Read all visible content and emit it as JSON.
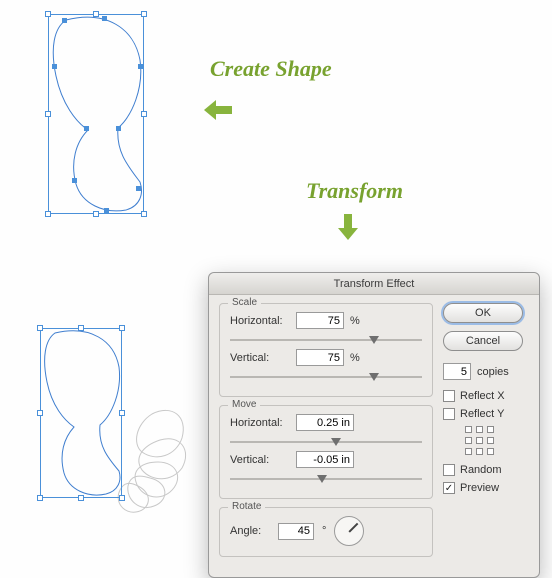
{
  "annotations": {
    "create_shape": "Create Shape",
    "transform": "Transform"
  },
  "dialog": {
    "title": "Transform Effect",
    "groups": {
      "scale": {
        "legend": "Scale",
        "horizontal_label": "Horizontal:",
        "horizontal_value": "75",
        "horizontal_unit": "%",
        "vertical_label": "Vertical:",
        "vertical_value": "75",
        "vertical_unit": "%"
      },
      "move": {
        "legend": "Move",
        "horizontal_label": "Horizontal:",
        "horizontal_value": "0.25 in",
        "vertical_label": "Vertical:",
        "vertical_value": "-0.05 in"
      },
      "rotate": {
        "legend": "Rotate",
        "angle_label": "Angle:",
        "angle_value": "45",
        "angle_unit": "°"
      }
    },
    "buttons": {
      "ok": "OK",
      "cancel": "Cancel"
    },
    "copies": {
      "value": "5",
      "label": "copies"
    },
    "options": {
      "reflect_x": "Reflect X",
      "reflect_y": "Reflect Y",
      "random": "Random",
      "preview": "Preview"
    },
    "checked": {
      "reflect_x": false,
      "reflect_y": false,
      "random": false,
      "preview": true
    }
  }
}
